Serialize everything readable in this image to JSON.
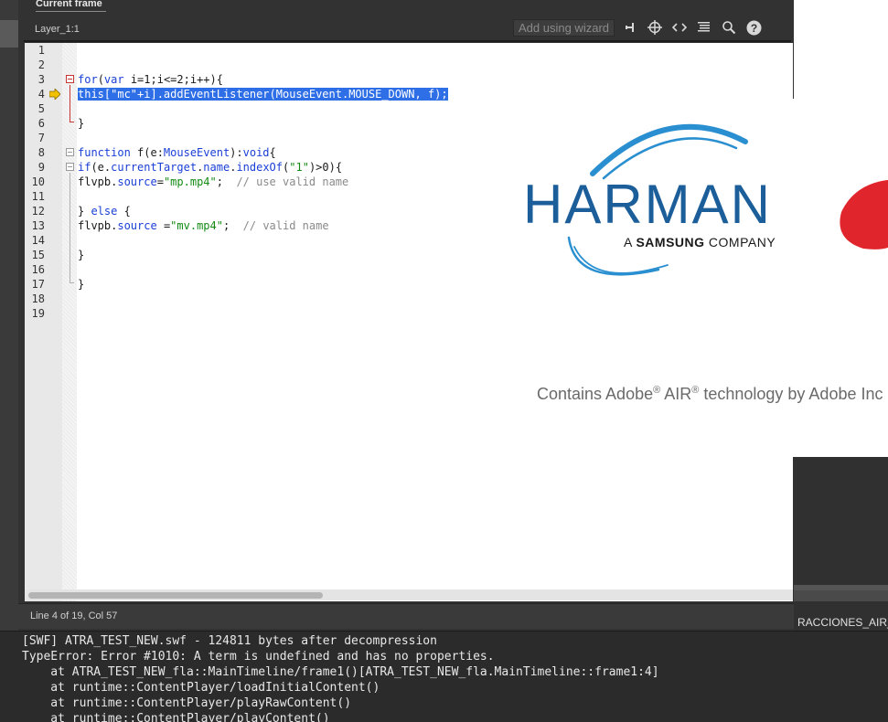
{
  "panel": {
    "title": "Current frame",
    "layer_label": "Layer_1:1"
  },
  "toolbar": {
    "wizard_label": "Add using wizard",
    "icons": [
      "pin-icon",
      "target-icon",
      "code-icon",
      "format-icon",
      "search-icon",
      "help-icon"
    ]
  },
  "editor": {
    "line_numbers": [
      "1",
      "2",
      "3",
      "4",
      "5",
      "6",
      "7",
      "8",
      "9",
      "10",
      "11",
      "12",
      "13",
      "14",
      "15",
      "16",
      "17",
      "18",
      "19"
    ],
    "lines": {
      "l3_kw": "for",
      "l3_a": "(",
      "l3_kw2": "var",
      "l3_b": " i=1;i<=2;i++){",
      "l4": "this[\"mc\"+i].addEventListener(MouseEvent.MOUSE_DOWN, f);",
      "l6": "}",
      "l8_kw": "function",
      "l8_a": " f(e:",
      "l8_cls": "MouseEvent",
      "l8_b": "):",
      "l8_kw2": "void",
      "l8_c": "{",
      "l9_kw": "if",
      "l9_a": "(e.",
      "l9_prop": "currentTarget",
      "l9_b": ".",
      "l9_prop2": "name",
      "l9_c": ".",
      "l9_prop3": "indexOf",
      "l9_d": "(",
      "l9_str": "\"1\"",
      "l9_e": ")>0){",
      "l10_a": "flvpb.",
      "l10_prop": "source",
      "l10_b": "=",
      "l10_str": "\"mp.mp4\"",
      "l10_c": ";  ",
      "l10_cmt": "// use valid name",
      "l12_a": "} ",
      "l12_kw": "else",
      "l12_b": " {",
      "l13_a": "flvpb.",
      "l13_prop": "source",
      "l13_b": " =",
      "l13_str": "\"mv.mp4\"",
      "l13_c": ";  ",
      "l13_cmt": "// valid name",
      "l15": "}",
      "l17": "}"
    }
  },
  "status": {
    "text": "Line 4 of 19, Col 57"
  },
  "splash": {
    "brand": "HARMAN",
    "tagline_a": "A ",
    "tagline_b": "SAMSUNG",
    "tagline_c": " COMPANY",
    "air_a": "Contains Adobe",
    "air_reg1": "®",
    "air_b": " AIR",
    "air_reg2": "®",
    "air_c": " technology by Adobe Inc"
  },
  "right_panel": {
    "fragment": "RACCIONES_AIR_"
  },
  "output": {
    "lines": [
      "[SWF] ATRA_TEST_NEW.swf - 124811 bytes after decompression",
      "TypeError: Error #1010: A term is undefined and has no properties.",
      "    at ATRA_TEST_NEW_fla::MainTimeline/frame1()[ATRA_TEST_NEW_fla.MainTimeline::frame1:4]",
      "    at runtime::ContentPlayer/loadInitialContent()",
      "    at runtime::ContentPlayer/playRawContent()",
      "    at runtime::ContentPlayer/playContent()"
    ]
  },
  "colors": {
    "keyword": "#1a3fd6",
    "string": "#138a14",
    "comment": "#8a8a8a",
    "selection": "#2e6ee6",
    "harman_blue": "#1b5e9a",
    "arc_blue": "#2a8fd0",
    "breakpoint_arrow": "#f2c200"
  }
}
